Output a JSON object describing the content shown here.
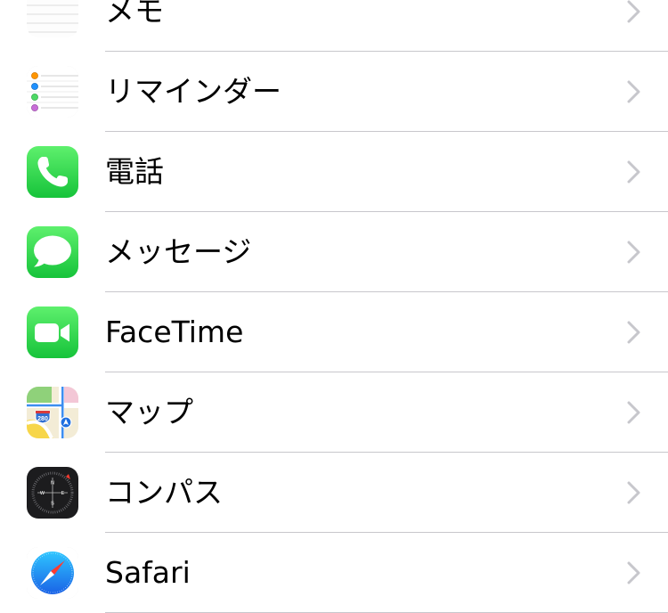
{
  "settings_list": {
    "items": [
      {
        "label": "メモ",
        "icon": "notes-icon"
      },
      {
        "label": "リマインダー",
        "icon": "reminders-icon"
      },
      {
        "label": "電話",
        "icon": "phone-icon"
      },
      {
        "label": "メッセージ",
        "icon": "messages-icon"
      },
      {
        "label": "FaceTime",
        "icon": "facetime-icon"
      },
      {
        "label": "マップ",
        "icon": "maps-icon"
      },
      {
        "label": "コンパス",
        "icon": "compass-icon"
      },
      {
        "label": "Safari",
        "icon": "safari-icon"
      }
    ],
    "chevron_icon": "chevron-right-icon"
  },
  "map_icon_shield": "280",
  "compass_letters": {
    "n": "N",
    "e": "E",
    "s": "S",
    "w": "W"
  },
  "colors": {
    "separator": "#c8c7cc",
    "chevron": "#c7c7cc",
    "green": "#34c759",
    "compass_bg": "#1c1c1e",
    "safari_blue": "#1e90ff"
  }
}
